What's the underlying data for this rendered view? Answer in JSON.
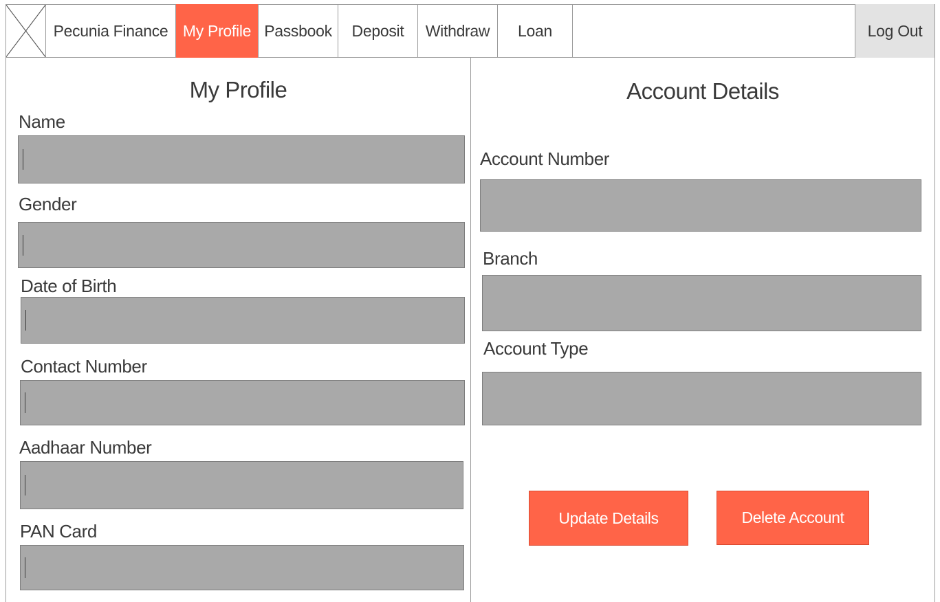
{
  "nav": {
    "brand": "Pecunia Finance",
    "items": [
      {
        "label": "My Profile",
        "active": true
      },
      {
        "label": "Passbook"
      },
      {
        "label": "Deposit"
      },
      {
        "label": "Withdraw"
      },
      {
        "label": "Loan"
      }
    ],
    "logout_label": "Log Out",
    "logo_icon": "image-placeholder-icon",
    "active_color": "#ff6448"
  },
  "profile": {
    "title": "My Profile",
    "fields": [
      {
        "label": "Name",
        "value": ""
      },
      {
        "label": "Gender",
        "value": ""
      },
      {
        "label": "Date of Birth",
        "value": ""
      },
      {
        "label": "Contact Number",
        "value": ""
      },
      {
        "label": "Aadhaar Number",
        "value": ""
      },
      {
        "label": "PAN Card",
        "value": ""
      }
    ]
  },
  "account": {
    "title": "Account Details",
    "fields": [
      {
        "label": "Account Number",
        "value": ""
      },
      {
        "label": "Branch",
        "value": ""
      },
      {
        "label": "Account Type",
        "value": ""
      }
    ],
    "update_label": "Update Details",
    "delete_label": "Delete Account"
  },
  "colors": {
    "accent": "#ff6448",
    "input_fill": "#a9a9a9",
    "logout_fill": "#e3e3e3"
  }
}
